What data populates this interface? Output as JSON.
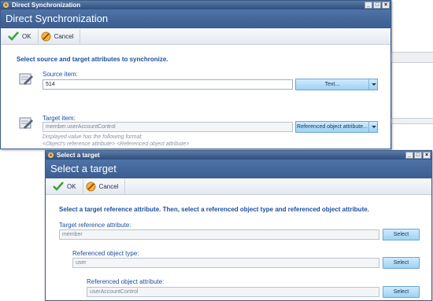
{
  "main_window": {
    "title": "Direct Synchronization",
    "banner": "Direct Synchronization",
    "toolbar": {
      "ok_label": "OK",
      "cancel_label": "Cancel"
    },
    "instruction": "Select source and target attributes to synchronize.",
    "source": {
      "label": "Source item:",
      "value": "514",
      "button_label": "Text..."
    },
    "target": {
      "label": "Target item:",
      "value": "member.userAccountControl",
      "button_label": "Referenced object attribute...",
      "hint_line1": "Displayed value has the following format:",
      "hint_line2": "<Object's reference attribute>.<Referenced object attribute>"
    }
  },
  "dialog": {
    "title": "Select a target",
    "banner": "Select a target",
    "toolbar": {
      "ok_label": "OK",
      "cancel_label": "Cancel"
    },
    "instruction": "Select a target reference attribute. Then, select a referenced object type and referenced object attribute.",
    "target_reference": {
      "label": "Target reference attribute:",
      "value": "member",
      "button_label": "Select"
    },
    "object_type": {
      "label": "Referenced object type:",
      "value": "user",
      "button_label": "Select"
    },
    "object_attribute": {
      "label": "Referenced object attribute:",
      "value": "userAccountControl",
      "button_label": "Select"
    }
  },
  "window_controls": {
    "minimize": "_",
    "maximize": "□",
    "close": "×"
  },
  "icons": {
    "app": "app-icon",
    "ok": "checkmark-icon",
    "cancel": "cancel-icon",
    "field": "pencil-page-icon"
  },
  "colors": {
    "title_bar": "#2f4f80",
    "banner": "#3b5d91",
    "accent_text": "#1a4f9c",
    "button": "#9fd2f3"
  }
}
